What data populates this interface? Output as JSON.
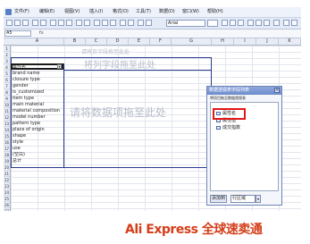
{
  "menubar": {
    "items": [
      "文件(F)",
      "编辑(E)",
      "视图(V)",
      "插入(I)",
      "格式(O)",
      "工具(T)",
      "数据(D)",
      "窗口(W)",
      "帮助(H)"
    ]
  },
  "toolbar": {
    "font_name": "Arial"
  },
  "formula_bar": {
    "name_box": "A5",
    "fx": "fx"
  },
  "grid": {
    "columns": [
      "A",
      "B",
      "C",
      "D",
      "E",
      "F",
      "G",
      "H",
      "I",
      "J",
      "K"
    ],
    "rows": [
      "1",
      "2",
      "3",
      "4",
      "5",
      "6",
      "7",
      "8",
      "9",
      "10",
      "11",
      "12",
      "13",
      "14",
      "15",
      "16",
      "17",
      "18",
      "19",
      "20",
      "21",
      "22",
      "23",
      "24",
      "25",
      "26",
      "27"
    ],
    "row_fields": [
      "属性名",
      "brand name",
      "closure type",
      "gender",
      "is_customized",
      "item type",
      "main material",
      "material composition",
      "model number",
      "pattern type",
      "place of origin",
      "shape",
      "style",
      "use",
      "(空白)",
      "总计"
    ]
  },
  "pivot": {
    "page_hint": "请将页字段拖至此处",
    "column_hint": "将列字段拖至此处",
    "data_hint": "请将数据项拖至此处",
    "dropdown_glyph": "▾"
  },
  "field_list": {
    "title": "数据透视表字段列表",
    "close_glyph": "×",
    "hint": "将项目拖至数据透视表",
    "items": [
      "属性名",
      "属性值",
      "成交指数"
    ],
    "add_button": "添加到",
    "target": "行区域",
    "target_arrow": "▾"
  },
  "footer": {
    "logo_text": "Ali Express 全球速卖通"
  },
  "colors": {
    "pivot_border": "#2a3d8f",
    "highlight": "#e01818",
    "panel_title": "#6c8ccc"
  }
}
